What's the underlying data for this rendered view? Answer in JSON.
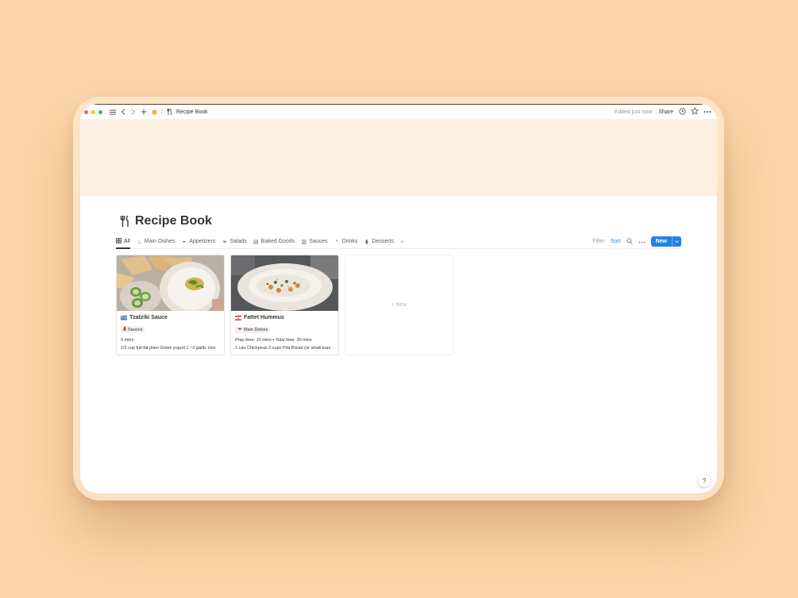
{
  "window": {
    "breadcrumb_sep": "/",
    "page_name": "Recipe Book",
    "edited": "Edited just now",
    "share": "Share",
    "traffic_lights": [
      "#fe5f57",
      "#febc2e",
      "#28c840"
    ]
  },
  "page": {
    "title": "Recipe Book",
    "icon": "fork-knife-icon"
  },
  "tabs": [
    {
      "label": "All",
      "icon": "grid-icon",
      "active": true
    },
    {
      "label": "Main Dishes",
      "icon": "pot-icon"
    },
    {
      "label": "Appetizers",
      "icon": "bowl-icon"
    },
    {
      "label": "Salads",
      "icon": "leaf-icon"
    },
    {
      "label": "Baked Goods",
      "icon": "bread-icon"
    },
    {
      "label": "Sauces",
      "icon": "sauce-icon"
    },
    {
      "label": "Drinks",
      "icon": "cup-icon"
    },
    {
      "label": "Desserts",
      "icon": "dessert-icon"
    }
  ],
  "actions": {
    "filter": "Filter",
    "sort": "Sort",
    "new": "New"
  },
  "cards": [
    {
      "title": "Tzatziki Sauce",
      "flag": "greece-flag",
      "tag": "Sauces",
      "time": "5 mins",
      "desc": "1/2 cup full-fat plain Greek yogurt 1 ~2 garlic clov"
    },
    {
      "title": "Fattet Hummus",
      "flag": "lebanon-flag",
      "tag": "Main Dishes",
      "time": "Prep time: 15 mins • Total time: 30 mins",
      "desc": "1 can Chickpeas 2 cups Pita Bread (or small toas"
    }
  ],
  "new_card": "+ New",
  "help": "?",
  "colors": {
    "accent": "#2383e2",
    "background": "#fcd6aa",
    "cover": "#fdf0e2"
  }
}
